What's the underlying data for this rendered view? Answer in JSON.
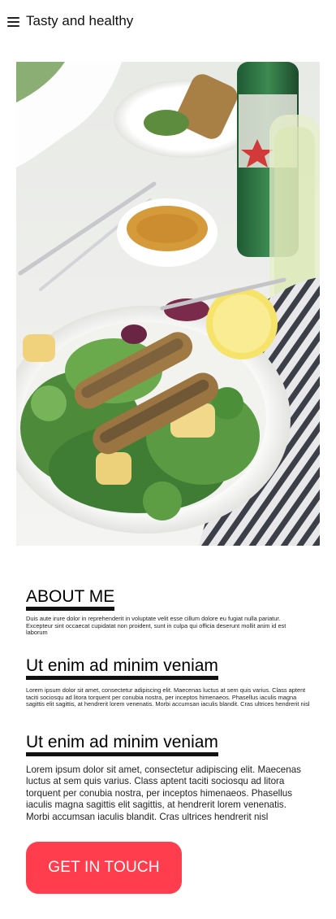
{
  "header": {
    "title": "Tasty and healthy",
    "menu_icon": "hamburger-menu-icon"
  },
  "hero": {
    "image_desc": "sardine-salad-photo"
  },
  "sections": [
    {
      "heading": "ABOUT ME",
      "body": "Duis aute irure dolor in reprehenderit in voluptate velit esse cillum dolore eu fugiat nulla pariatur. Excepteur sint occaecat cupidatat non proident, sunt in culpa qui officia deserunt mollit anim id est laborum"
    },
    {
      "heading": "Ut enim ad minim veniam",
      "body": "Lorem ipsum dolor sit amet, consectetur adipiscing elit. Maecenas luctus at sem quis varius. Class aptent taciti sociosqu ad litora torquent per conubia nostra, per inceptos himenaeos. Phasellus iaculis magna sagittis elit sagittis, at hendrerit lorem venenatis. Morbi accumsan iaculis blandit. Cras ultrices hendrerit nisl"
    },
    {
      "heading": "Ut enim ad minim veniam",
      "body": "Lorem ipsum dolor sit amet, consectetur adipiscing elit. Maecenas luctus at sem quis varius. Class aptent taciti sociosqu ad litora torquent per conubia nostra, per inceptos himenaeos. Phasellus iaculis magna sagittis elit sagittis, at hendrerit lorem venenatis. Morbi accumsan iaculis blandit. Cras ultrices hendrerit nisl"
    }
  ],
  "cta": {
    "label": "GET IN TOUCH"
  },
  "colors": {
    "accent": "#ff3d4c",
    "text": "#111111",
    "background": "#ffffff"
  }
}
